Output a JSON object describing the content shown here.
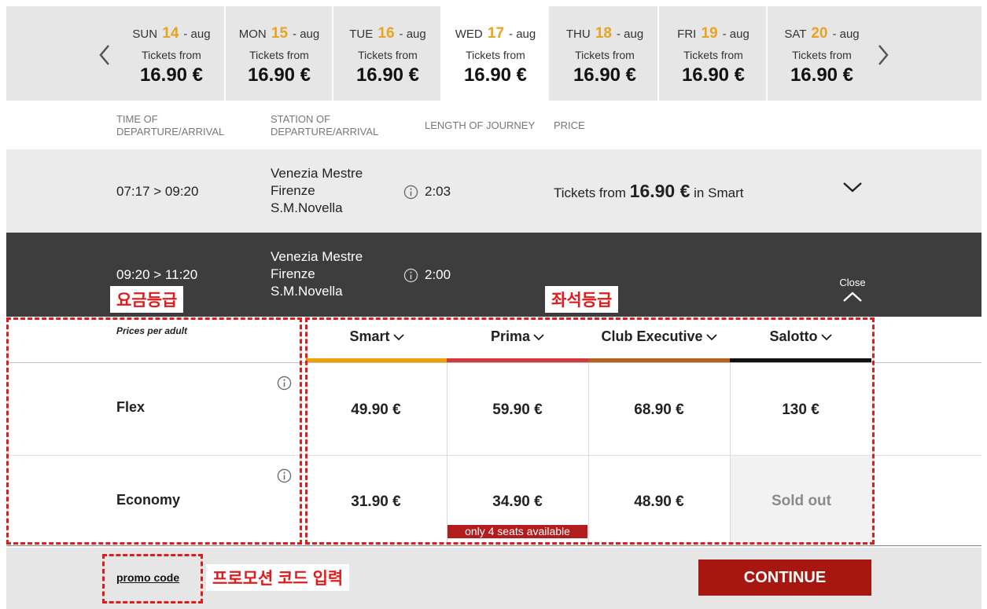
{
  "date_strip": {
    "days": [
      {
        "dow": "SUN",
        "num": "14",
        "month": "- aug",
        "sub": "Tickets from",
        "price": "16.90 €"
      },
      {
        "dow": "MON",
        "num": "15",
        "month": "- aug",
        "sub": "Tickets from",
        "price": "16.90 €"
      },
      {
        "dow": "TUE",
        "num": "16",
        "month": "- aug",
        "sub": "Tickets from",
        "price": "16.90 €"
      },
      {
        "dow": "WED",
        "num": "17",
        "month": "- aug",
        "sub": "Tickets from",
        "price": "16.90 €"
      },
      {
        "dow": "THU",
        "num": "18",
        "month": "- aug",
        "sub": "Tickets from",
        "price": "16.90 €"
      },
      {
        "dow": "FRI",
        "num": "19",
        "month": "- aug",
        "sub": "Tickets from",
        "price": "16.90 €"
      },
      {
        "dow": "SAT",
        "num": "20",
        "month": "- aug",
        "sub": "Tickets from",
        "price": "16.90 €"
      }
    ],
    "active": "WED"
  },
  "columns": {
    "time": [
      "TIME OF",
      "DEPARTURE/ARRIVAL"
    ],
    "station": [
      "STATION OF",
      "DEPARTURE/ARRIVAL"
    ],
    "length": "LENGTH OF JOURNEY",
    "price": "PRICE"
  },
  "journeys": [
    {
      "time": "07:17 > 09:20",
      "station": [
        "Venezia Mestre",
        "Firenze",
        "S.M.Novella"
      ],
      "duration": "2:03",
      "tickets_prefix": "Tickets from",
      "tickets_price": "16.90 €",
      "tickets_suffix": "in Smart"
    },
    {
      "time": "09:20 > 11:20",
      "station": [
        "Venezia Mestre",
        "Firenze",
        "S.M.Novella"
      ],
      "duration": "2:00",
      "close_label": "Close"
    }
  ],
  "annotations": {
    "fare_class": "요금등급",
    "seat_class": "좌석등급",
    "promo_entry": "프로모션 코드 입력"
  },
  "fare_table": {
    "prices_per_adult": "Prices per adult",
    "classes": [
      {
        "name": "Smart",
        "color": "#f0a000"
      },
      {
        "name": "Prima",
        "color": "#d43a3a"
      },
      {
        "name": "Club Executive",
        "color": "#b8601f"
      },
      {
        "name": "Salotto",
        "color": "#111111"
      }
    ],
    "fares": [
      {
        "name": "Flex",
        "prices": [
          "49.90 €",
          "59.90 €",
          "68.90 €",
          "130 €"
        ]
      },
      {
        "name": "Economy",
        "prices": [
          "31.90 €",
          "34.90 €",
          "48.90 €"
        ],
        "sold_out": "Sold out",
        "seats_note": "only 4 seats available"
      }
    ]
  },
  "footer": {
    "promo_code": "promo code",
    "continue": "CONTINUE"
  }
}
